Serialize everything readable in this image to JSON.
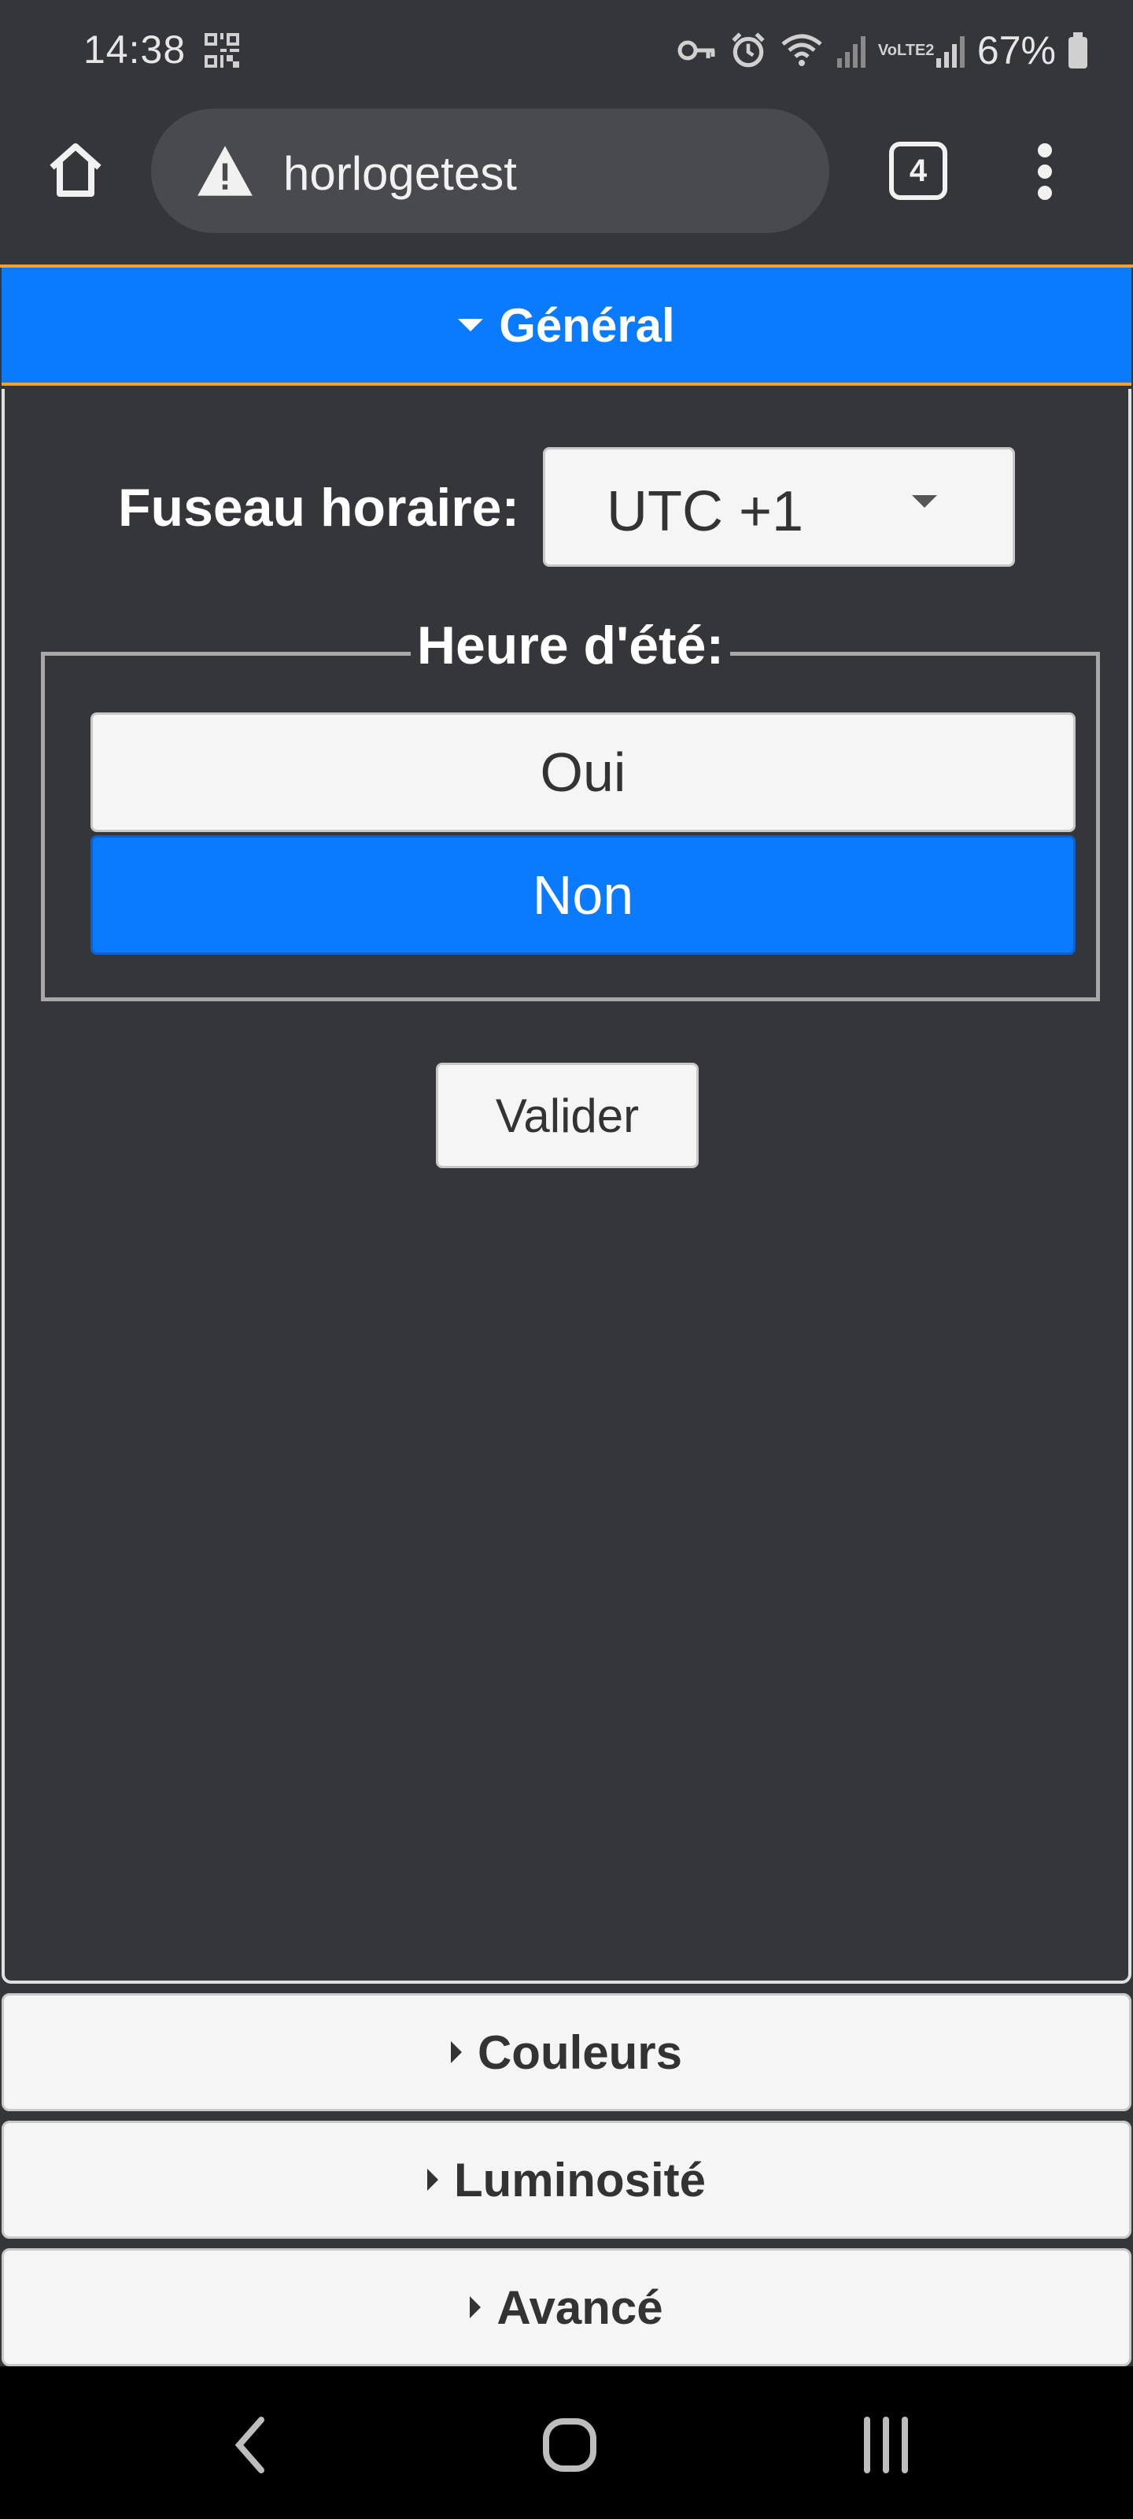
{
  "status_bar": {
    "time": "14:38",
    "network_label": "VoLTE2",
    "battery_percent": "67%",
    "icons": [
      "qr-code-icon",
      "key-icon",
      "alarm-icon",
      "wifi-icon",
      "signal-icon",
      "signal-icon",
      "battery-icon"
    ]
  },
  "browser": {
    "url": "horlogetest",
    "tab_count": "4",
    "icons": [
      "home-icon",
      "warning-icon",
      "tabs-icon",
      "more-vert-icon"
    ]
  },
  "sections": {
    "general": {
      "title": "Général",
      "expanded": true
    },
    "couleurs": {
      "title": "Couleurs"
    },
    "luminosite": {
      "title": "Luminosité"
    },
    "avance": {
      "title": "Avancé"
    }
  },
  "general": {
    "timezone_label": "Fuseau horaire:",
    "timezone_value": "UTC +1",
    "dst_legend": "Heure d'été:",
    "dst_options": [
      "Oui",
      "Non"
    ],
    "dst_selected": "Non",
    "submit_label": "Valider"
  },
  "colors": {
    "accent": "#0a7bff",
    "focus_outline": "#f0a030",
    "background": "#35363a"
  },
  "nav_bar": {
    "icons": [
      "back-icon",
      "home-circle-icon",
      "recents-icon"
    ]
  }
}
